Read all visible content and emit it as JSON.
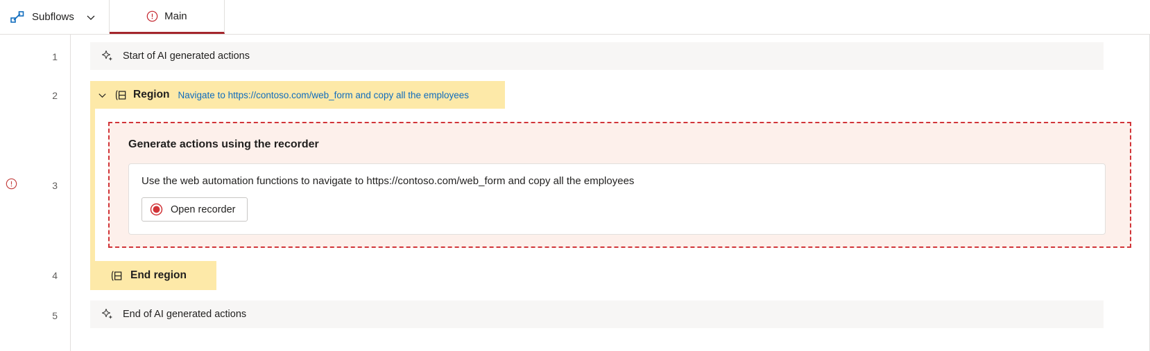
{
  "header": {
    "subflows_label": "Subflows",
    "subflows_icon": "subflow-diagram-icon",
    "subflows_chevron_icon": "chevron-down-icon",
    "tab_main_label": "Main",
    "tab_main_status_icon": "error-circle-icon",
    "accent_error_color": "#a4262c"
  },
  "gutter": {
    "row_numbers": [
      "1",
      "2",
      "3",
      "4",
      "5"
    ],
    "error_icon": "error-circle-icon"
  },
  "flow": {
    "row1": {
      "icon": "ai-sparkle-icon",
      "label": "Start of AI generated actions"
    },
    "row2": {
      "chevron_icon": "chevron-down-icon",
      "region_icon": "region-icon",
      "title": "Region",
      "description": "Navigate to https://contoso.com/web_form and copy all the employees",
      "background_color": "#fde9a8",
      "description_color": "#0f6cbd"
    },
    "row3": {
      "panel_heading": "Generate actions using the recorder",
      "panel_border_color": "#d13438",
      "panel_background": "#fdf0eb",
      "card_text": "Use the web automation functions to navigate to https://contoso.com/web_form and copy all the employees",
      "button_label": "Open recorder",
      "button_icon": "record-circle-icon"
    },
    "row4": {
      "region_icon": "region-icon",
      "title": "End region",
      "background_color": "#fde9a8"
    },
    "row5": {
      "icon": "ai-sparkle-icon",
      "label": "End of AI generated actions"
    }
  }
}
